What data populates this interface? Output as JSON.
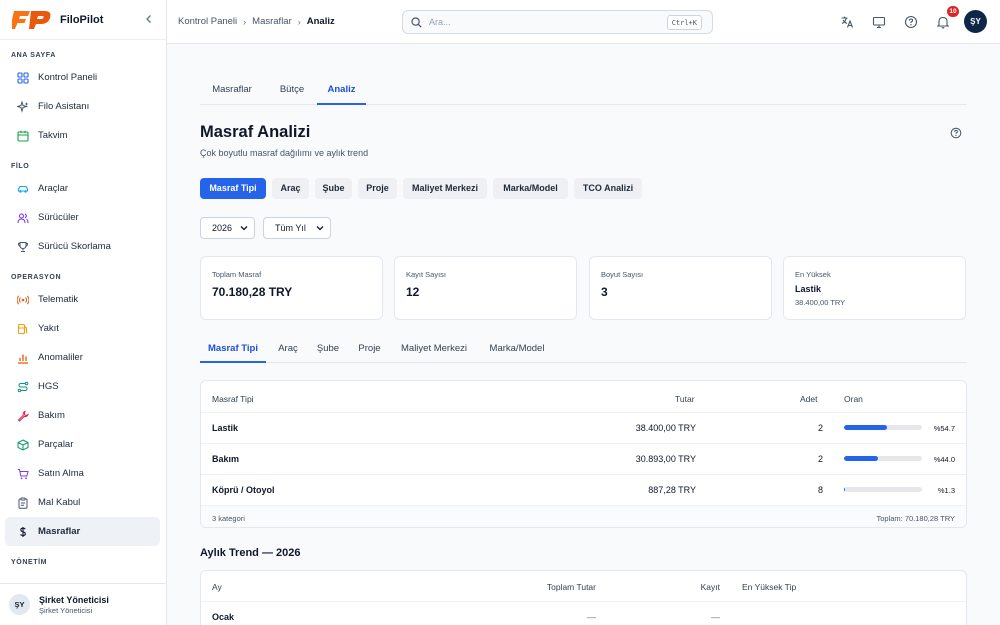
{
  "brand": {
    "name": "FiloPilot",
    "logo_text": "FP"
  },
  "sidebar": {
    "sections": [
      {
        "title": "ANA SAYFA",
        "items": [
          "Kontrol Paneli",
          "Filo Asistanı",
          "Takvim"
        ]
      },
      {
        "title": "FİLO",
        "items": [
          "Araçlar",
          "Sürücüler",
          "Sürücü Skorlama"
        ]
      },
      {
        "title": "OPERASYON",
        "items": [
          "Telematik",
          "Yakıt",
          "Anomaliler",
          "HGS",
          "Bakım",
          "Parçalar",
          "Satın Alma",
          "Mal Kabul",
          "Masraflar"
        ]
      },
      {
        "title": "YÖNETİM",
        "items": []
      }
    ],
    "active_item": "Masraflar",
    "user": {
      "initials": "ŞY",
      "name": "Şirket Yöneticisi",
      "role": "Şirket Yöneticisi"
    }
  },
  "topbar": {
    "breadcrumb": [
      "Kontrol Paneli",
      "Masraflar",
      "Analiz"
    ],
    "search": {
      "placeholder": "Ara...",
      "shortcut": "Ctrl+K"
    },
    "notification_count": "10",
    "avatar_initials": "ŞY"
  },
  "main": {
    "tabs": [
      "Masraflar",
      "Bütçe",
      "Analiz"
    ],
    "active_tab": "Analiz",
    "title": "Masraf Analizi",
    "subtitle": "Çok boyutlu masraf dağılımı ve aylık trend",
    "dimension_pills": [
      "Masraf Tipi",
      "Araç",
      "Şube",
      "Proje",
      "Maliyet Merkezi",
      "Marka/Model",
      "TCO Analizi"
    ],
    "active_pill": "Masraf Tipi",
    "filters": {
      "year": "2026",
      "period": "Tüm Yıl"
    },
    "stats": [
      {
        "label": "Toplam Masraf",
        "value": "70.180,28 TRY"
      },
      {
        "label": "Kayıt Sayısı",
        "value": "12"
      },
      {
        "label": "Boyut Sayısı",
        "value": "3"
      },
      {
        "label": "En Yüksek",
        "value": "Lastik",
        "sub": "38.400,00 TRY"
      }
    ],
    "sub_tabs": [
      "Masraf Tipi",
      "Araç",
      "Şube",
      "Proje",
      "Maliyet Merkezi",
      "Marka/Model"
    ],
    "breakdown": {
      "headers": [
        "Masraf Tipi",
        "Tutar",
        "Adet",
        "Oran"
      ],
      "rows": [
        {
          "type": "Lastik",
          "amount": "38.400,00 TRY",
          "count": "2",
          "ratio_label": "%54.7",
          "ratio": 0.547
        },
        {
          "type": "Bakım",
          "amount": "30.893,00 TRY",
          "count": "2",
          "ratio_label": "%44.0",
          "ratio": 0.44
        },
        {
          "type": "Köprü / Otoyol",
          "amount": "887,28 TRY",
          "count": "8",
          "ratio_label": "%1.3",
          "ratio": 0.013
        }
      ],
      "footer_left": "3 kategori",
      "footer_right": "Toplam: 70.180,28 TRY"
    },
    "monthly": {
      "title": "Aylık Trend — 2026",
      "headers": [
        "Ay",
        "Toplam Tutar",
        "Kayıt",
        "En Yüksek Tip"
      ],
      "rows": [
        {
          "month": "Ocak",
          "total": "—",
          "count": "—",
          "top": ""
        }
      ]
    }
  }
}
